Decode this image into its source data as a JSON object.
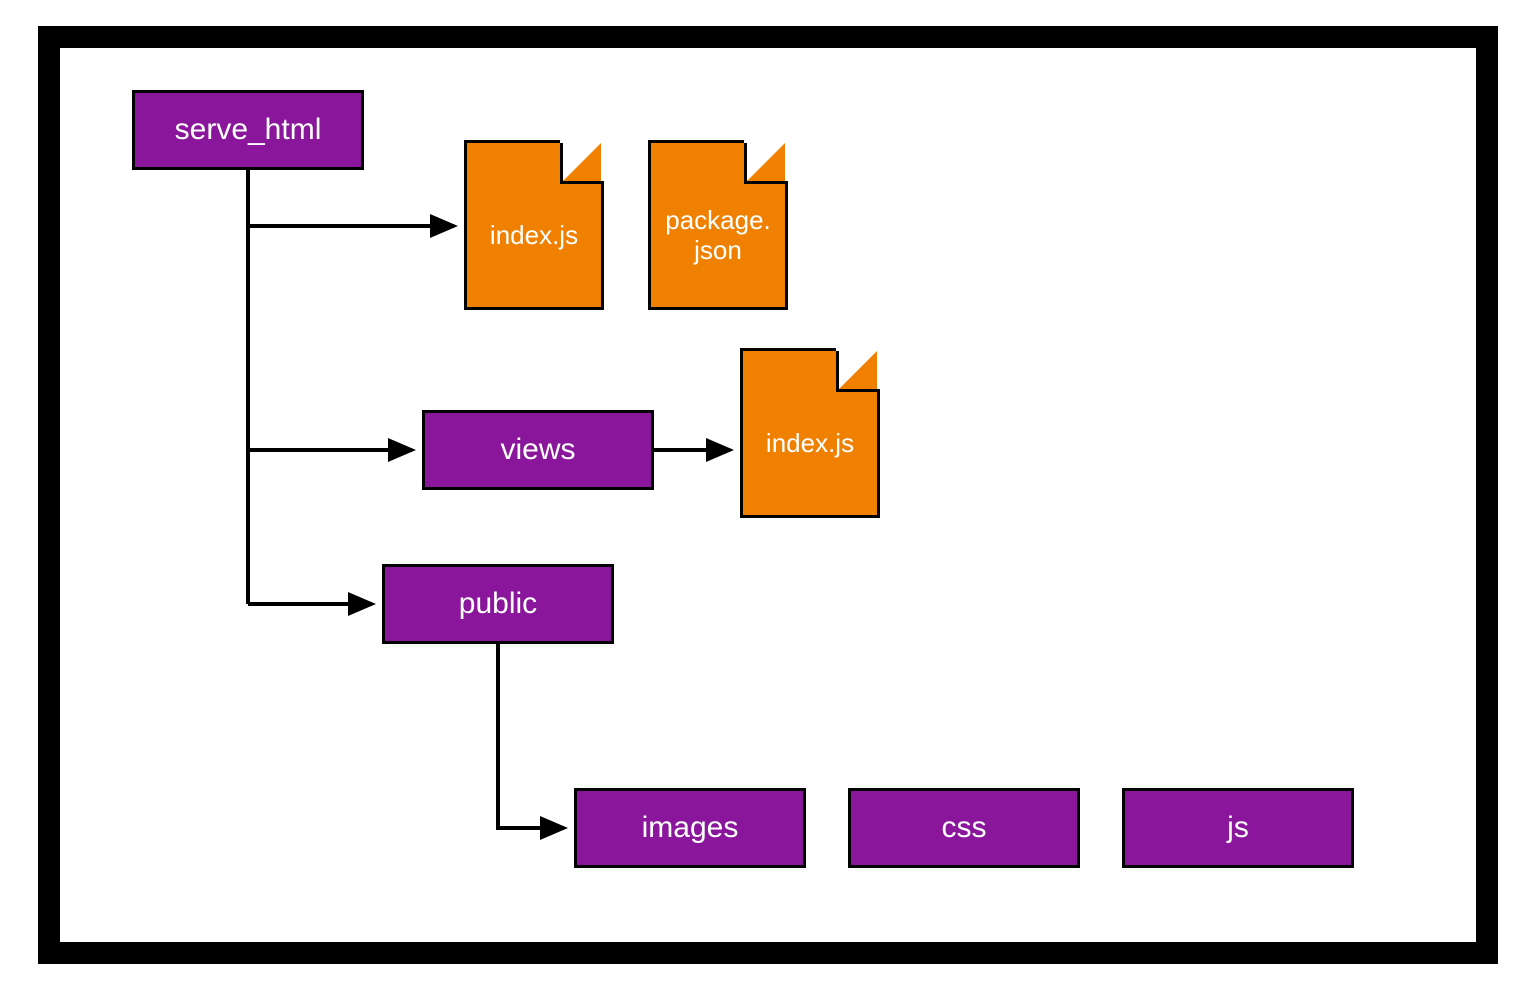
{
  "colors": {
    "folder_fill": "#8A169B",
    "file_fill": "#F08000",
    "stroke": "#000000",
    "text": "#ffffff"
  },
  "nodes": {
    "root": {
      "label": "serve_html",
      "type": "folder"
    },
    "file_index_root": {
      "label": "index.js",
      "type": "file"
    },
    "file_package": {
      "label": "package.\njson",
      "type": "file"
    },
    "folder_views": {
      "label": "views",
      "type": "folder"
    },
    "file_index_views": {
      "label": "index.js",
      "type": "file"
    },
    "folder_public": {
      "label": "public",
      "type": "folder"
    },
    "folder_images": {
      "label": "images",
      "type": "folder"
    },
    "folder_css": {
      "label": "css",
      "type": "folder"
    },
    "folder_js": {
      "label": "js",
      "type": "folder"
    }
  },
  "edges": [
    {
      "from": "root",
      "to": "file_index_root"
    },
    {
      "from": "root",
      "to": "folder_views"
    },
    {
      "from": "root",
      "to": "folder_public"
    },
    {
      "from": "folder_views",
      "to": "file_index_views"
    },
    {
      "from": "folder_public",
      "to": "folder_images"
    }
  ]
}
